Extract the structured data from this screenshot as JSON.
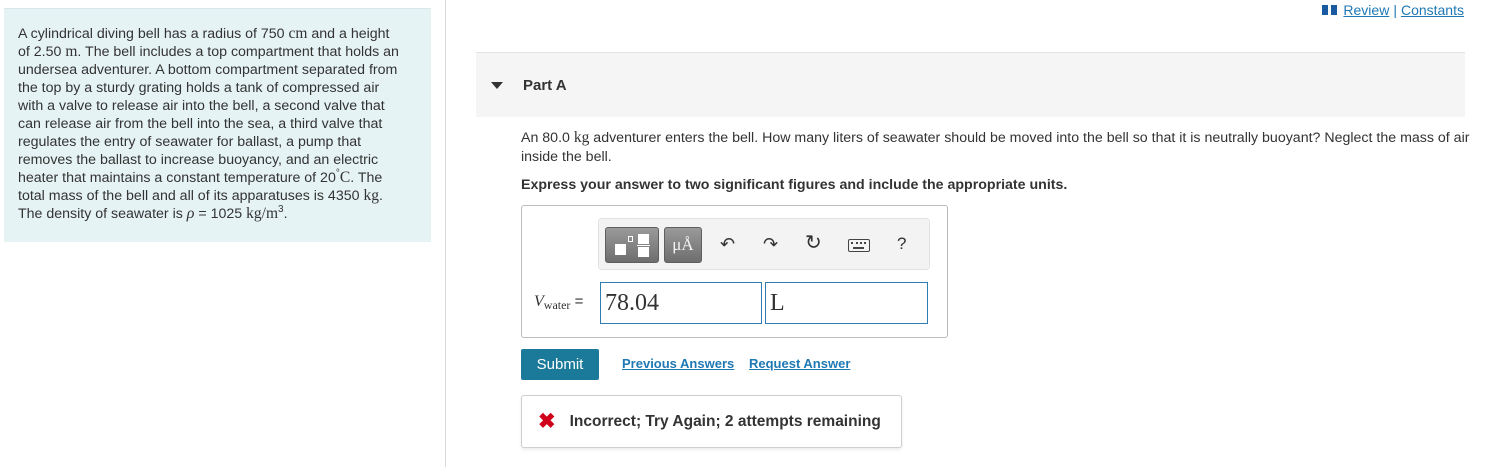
{
  "problem": {
    "lines": [
      [
        "A cylindrical diving bell has a radius of 750 ",
        "cm",
        " and a height"
      ],
      [
        "of 2.50 ",
        "m",
        ". The bell includes a top compartment that holds an"
      ],
      [
        "undersea adventurer. A bottom compartment separated from"
      ],
      [
        "the top by a sturdy grating holds a tank of compressed air"
      ],
      [
        "with a valve to release air into the bell, a second valve that"
      ],
      [
        "can release air from the bell into the sea, a third valve that"
      ],
      [
        "regulates the entry of seawater for ballast, a pump that"
      ],
      [
        "removes the ballast to increase buoyancy, and an electric"
      ],
      [
        "heater that maintains a constant temperature of 20",
        "°",
        "C",
        ". The"
      ],
      [
        "total mass of the bell and all of its apparatuses is 4350 ",
        "kg",
        "."
      ],
      [
        "The density of seawater is ",
        "ρ",
        " = 1025 ",
        "kg/m",
        "3",
        "."
      ]
    ]
  },
  "top_links": {
    "review": "Review",
    "separator": "|",
    "constants": "Constants"
  },
  "part": {
    "title": "Part A"
  },
  "question": {
    "prefix": "An 80.0 ",
    "unit": "kg",
    "suffix": " adventurer enters the bell. How many liters of seawater should be moved into the bell so that it is neutrally buoyant? Neglect the mass of air inside the bell."
  },
  "instruction": "Express your answer to two significant figures and include the appropriate units.",
  "toolbar": {
    "template_icon": "templates-icon",
    "units_label": "μÅ",
    "undo_icon": "↶",
    "redo_icon": "↷",
    "reset_icon": "↻",
    "help_label": "?"
  },
  "answer": {
    "var_symbol": "V",
    "var_subscript": "water",
    "equals": "=",
    "value": "78.04",
    "units": "L"
  },
  "actions": {
    "submit": "Submit",
    "previous_answers": "Previous Answers",
    "request_answer": "Request Answer"
  },
  "feedback": {
    "icon": "✖",
    "text": "Incorrect; Try Again; 2 attempts remaining",
    "color": "#d0021b"
  },
  "colors": {
    "panel_bg": "#e6f3f5",
    "submit_bg": "#1b7a99",
    "link": "#1f78b4",
    "field_border": "#2e7cb0"
  }
}
